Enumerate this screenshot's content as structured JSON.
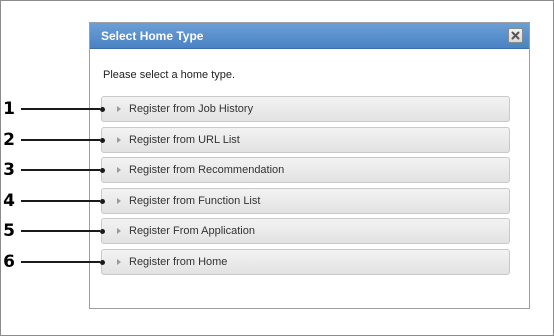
{
  "dialog": {
    "title": "Select Home Type",
    "instruction": "Please select a home type.",
    "close_icon": "close-icon",
    "options": [
      {
        "label": "Register from Job History"
      },
      {
        "label": "Register from URL List"
      },
      {
        "label": "Register from Recommendation"
      },
      {
        "label": "Register from Function List"
      },
      {
        "label": "Register From Application"
      },
      {
        "label": "Register from Home"
      }
    ]
  },
  "callouts": [
    "1",
    "2",
    "3",
    "4",
    "5",
    "6"
  ],
  "colors": {
    "title_bar": "#4a82c4",
    "option_bg": "#e8e8e8"
  }
}
